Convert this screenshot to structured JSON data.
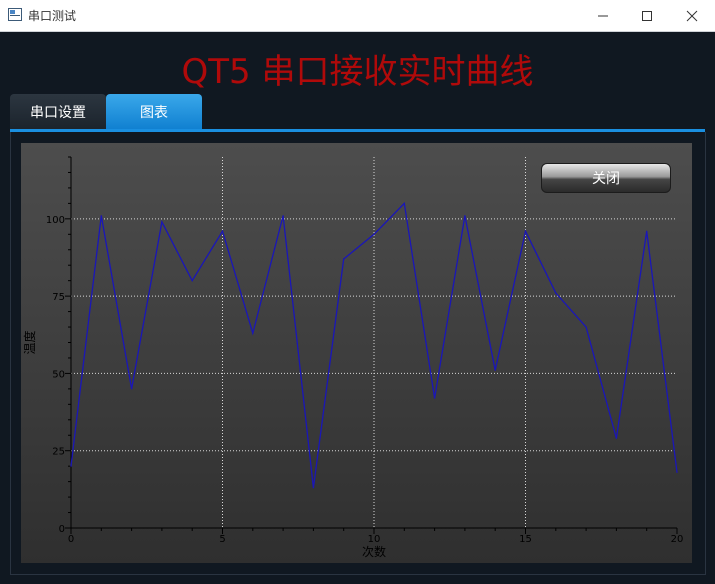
{
  "window": {
    "title": "串口测试",
    "minimize_icon": "minimize-icon",
    "maximize_icon": "maximize-icon",
    "close_icon": "close-icon"
  },
  "header": {
    "title": "QT5 串口接收实时曲线"
  },
  "tabs": [
    {
      "label": "串口设置",
      "active": false
    },
    {
      "label": "图表",
      "active": true
    }
  ],
  "close_button": {
    "label": "关闭"
  },
  "colors": {
    "accent": "#1a8fe0",
    "title_red": "#b00a0a",
    "series_line": "#1a16b8"
  },
  "chart_data": {
    "type": "line",
    "xlabel": "次数",
    "ylabel": "温度",
    "xlim": [
      0,
      20
    ],
    "ylim": [
      0,
      120
    ],
    "x_ticks": [
      0,
      5,
      10,
      15,
      20
    ],
    "y_ticks": [
      0,
      25,
      50,
      75,
      100
    ],
    "grid": true,
    "series": [
      {
        "x": [
          0,
          1,
          2,
          3,
          4,
          5,
          6,
          7,
          8,
          9,
          10,
          11,
          12,
          13,
          14,
          15,
          16,
          17,
          18,
          19,
          20
        ],
        "values": [
          20,
          101,
          45,
          99,
          80,
          96,
          63,
          101,
          13,
          87,
          95,
          105,
          42,
          101,
          51,
          96,
          76,
          65,
          29,
          96,
          18
        ]
      }
    ]
  }
}
